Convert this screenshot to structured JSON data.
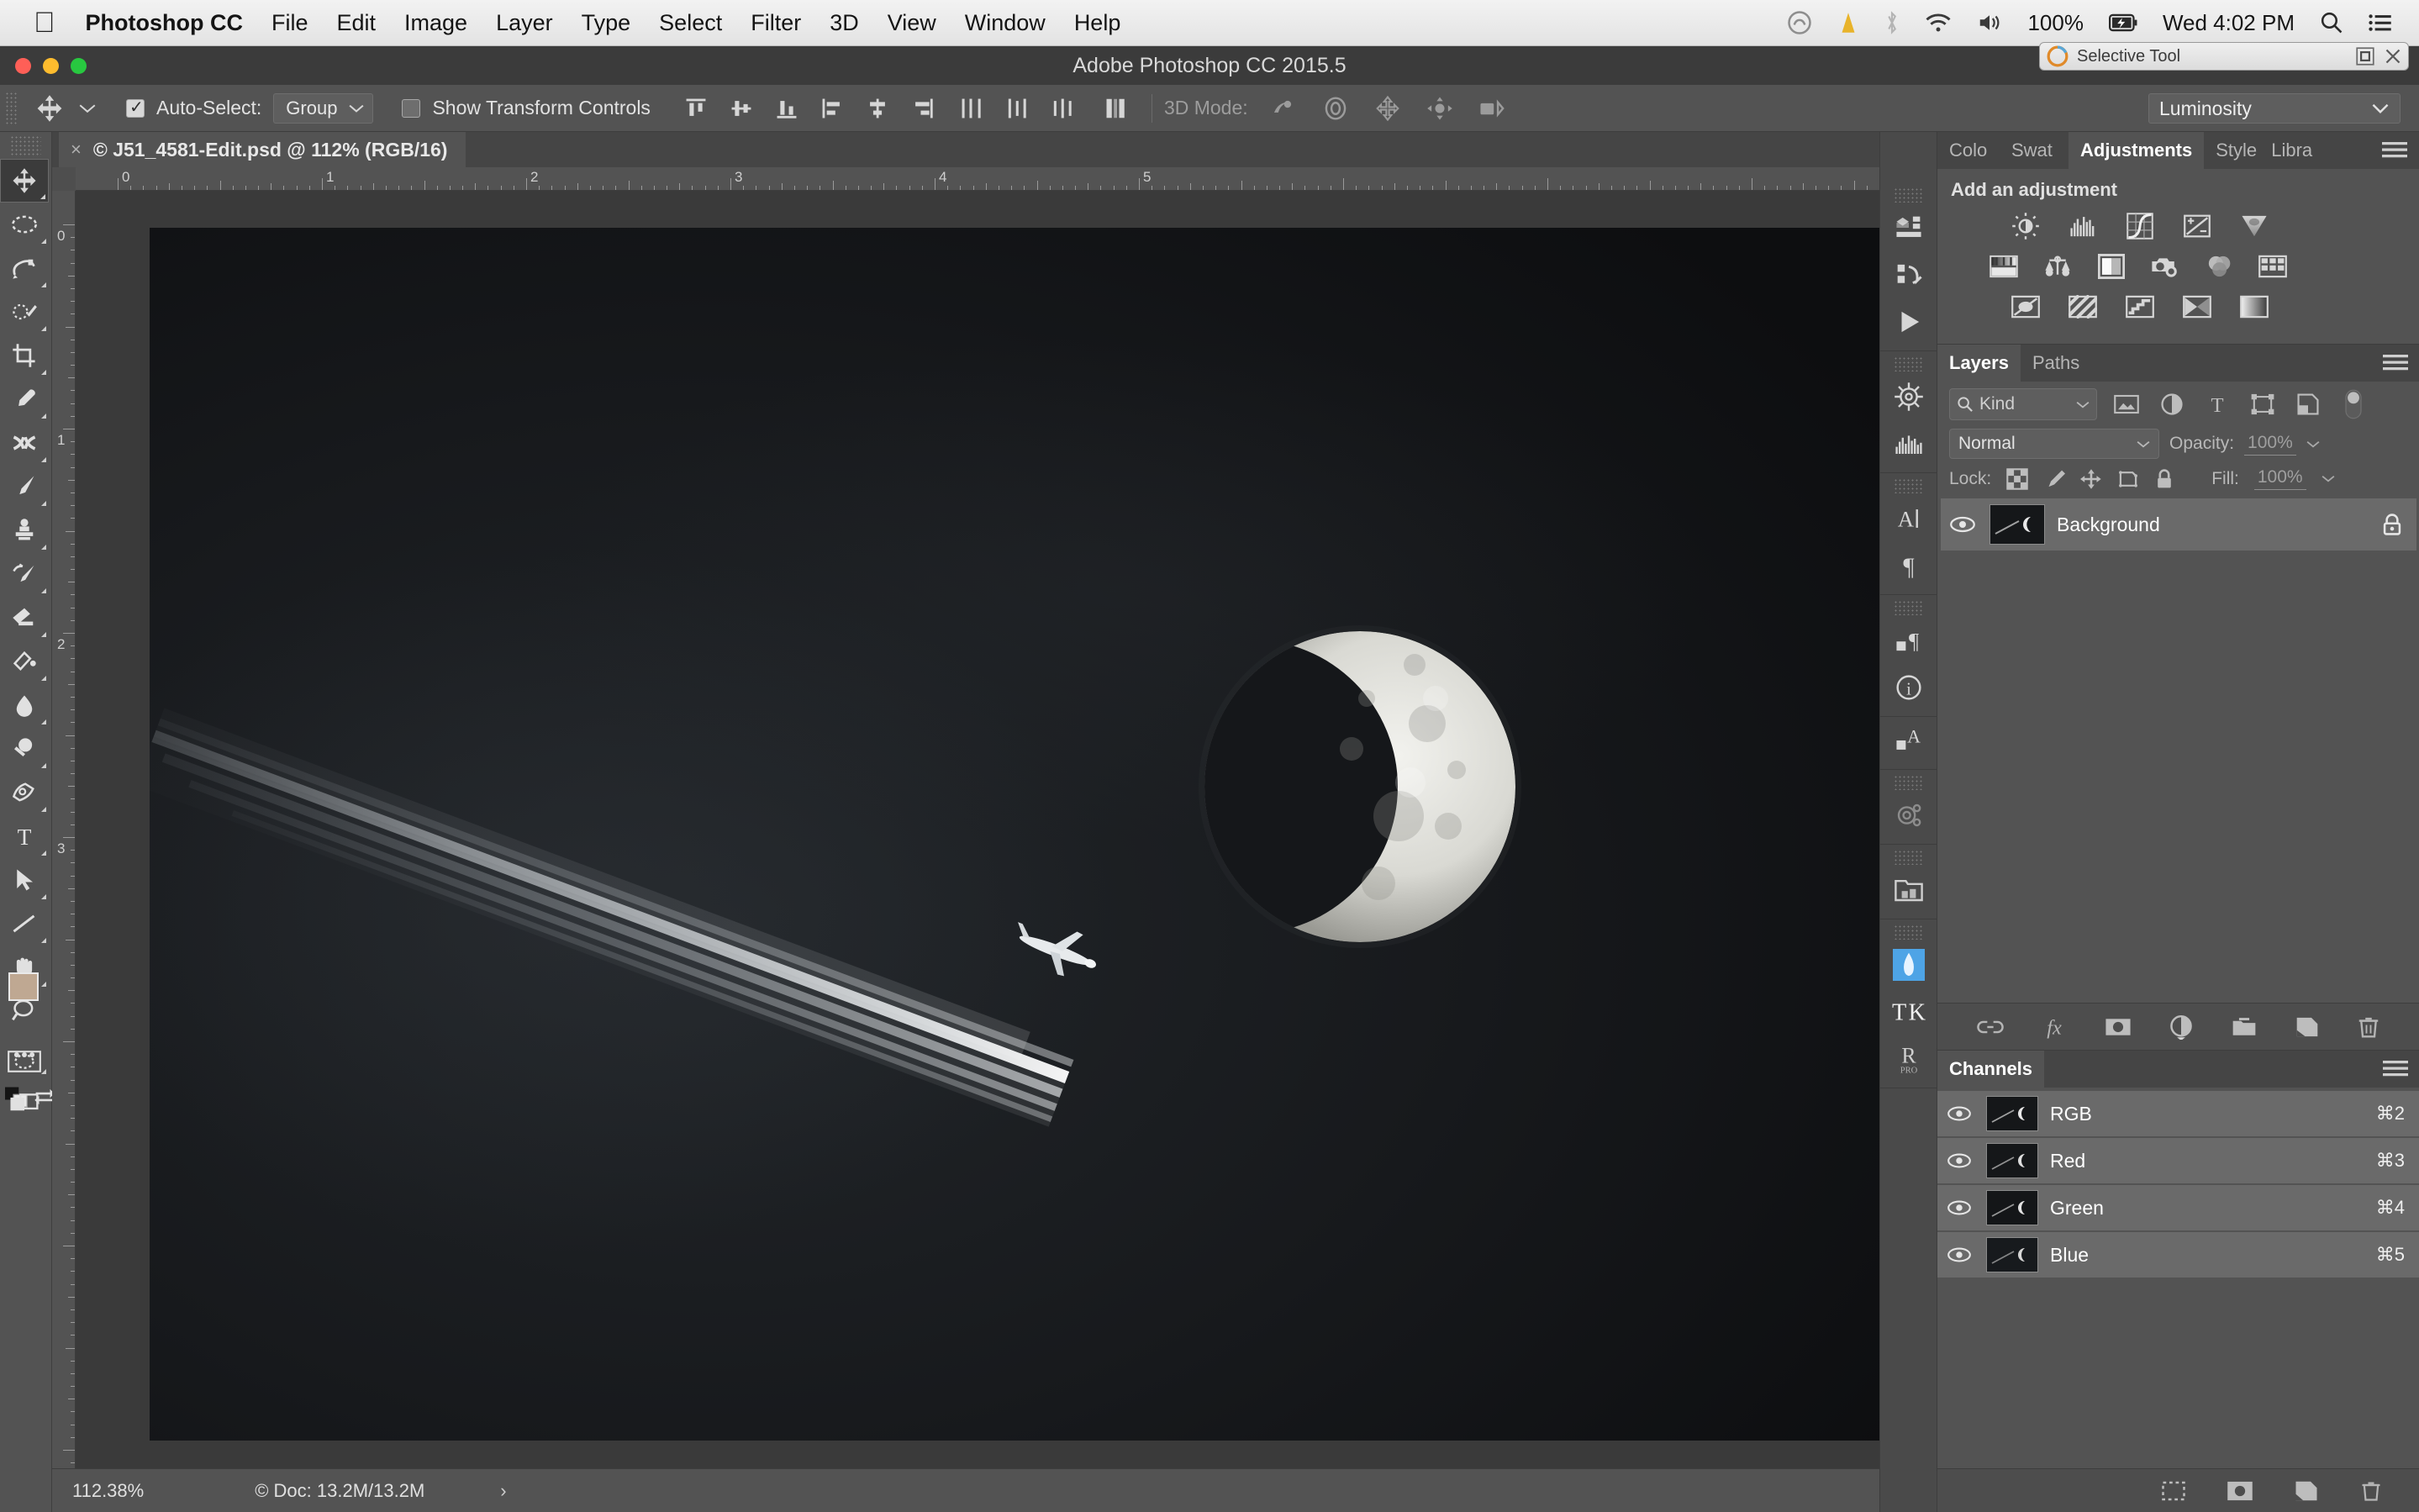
{
  "menubar": {
    "apple_icon": "apple-icon",
    "app_name": "Photoshop CC",
    "items": [
      "File",
      "Edit",
      "Image",
      "Layer",
      "Type",
      "Select",
      "Filter",
      "3D",
      "View",
      "Window",
      "Help"
    ],
    "status": {
      "creative_cloud_icon": "creative-cloud-icon",
      "dropbox_icon": "dropbox-icon",
      "bluetooth_icon": "bluetooth-icon",
      "wifi_icon": "wifi-icon",
      "volume_icon": "volume-icon",
      "battery_percent": "100%",
      "battery_icon": "battery-charging-icon",
      "clock": "Wed 4:02 PM",
      "spotlight_icon": "search-icon",
      "notification_icon": "notification-center-icon"
    }
  },
  "titlebar": {
    "title": "Adobe Photoshop CC 2015.5"
  },
  "selective_tool": {
    "title": "Selective Tool",
    "logo_icon": "selective-tool-logo-icon",
    "maximize_icon": "maximize-icon",
    "close_icon": "close-icon"
  },
  "options_bar": {
    "tool_icon": "move-tool-icon",
    "tool_preset_caret": "chevron-down-icon",
    "auto_select_label": "Auto-Select:",
    "auto_select_checked": true,
    "auto_select_value": "Group",
    "show_transform_label": "Show Transform Controls",
    "show_transform_checked": false,
    "align_icons": [
      "align-top-edges",
      "align-vertical-centers",
      "align-bottom-edges",
      "align-left-edges",
      "align-horizontal-centers",
      "align-right-edges"
    ],
    "distribute_icons": [
      "distribute-top-edges",
      "distribute-vertical-centers",
      "distribute-bottom-edges",
      "distribute-left-edges",
      "distribute-horizontal-centers",
      "distribute-right-edges"
    ],
    "auto_align_icon": "auto-align-layers-icon",
    "mode_3d_label": "3D Mode:",
    "mode_3d_icons": [
      "rotate-3d-object-icon",
      "roll-3d-object-icon",
      "drag-3d-object-icon",
      "slide-3d-object-icon",
      "scale-3d-object-icon"
    ],
    "blend_mode": "Luminosity"
  },
  "document_tab": {
    "close_icon": "close-icon",
    "label": "© J51_4581-Edit.psd @ 112% (RGB/16)"
  },
  "rulers": {
    "horizontal_labels": [
      "0",
      "1",
      "2",
      "3",
      "4",
      "5"
    ],
    "vertical_labels": [
      "0",
      "1",
      "2",
      "3"
    ],
    "unit": "inches"
  },
  "status_bar": {
    "zoom": "112.38%",
    "doc_info": "© Doc: 13.2M/13.2M",
    "expand_icon": "chevron-right-icon"
  },
  "toolbar": {
    "tools": [
      {
        "name": "move-tool",
        "active": true,
        "has_flyout": true
      },
      {
        "name": "elliptical-marquee-tool",
        "active": false,
        "has_flyout": true
      },
      {
        "name": "magnetic-lasso-tool",
        "active": false,
        "has_flyout": true
      },
      {
        "name": "quick-selection-tool",
        "active": false,
        "has_flyout": true
      },
      {
        "name": "crop-tool",
        "active": false,
        "has_flyout": true
      },
      {
        "name": "eyedropper-tool",
        "active": false,
        "has_flyout": true
      },
      {
        "name": "healing-brush-tool",
        "active": false,
        "has_flyout": true
      },
      {
        "name": "brush-tool",
        "active": false,
        "has_flyout": true
      },
      {
        "name": "clone-stamp-tool",
        "active": false,
        "has_flyout": true
      },
      {
        "name": "history-brush-tool",
        "active": false,
        "has_flyout": true
      },
      {
        "name": "eraser-tool",
        "active": false,
        "has_flyout": true
      },
      {
        "name": "gradient-tool",
        "active": false,
        "has_flyout": true
      },
      {
        "name": "blur-tool",
        "active": false,
        "has_flyout": true
      },
      {
        "name": "dodge-tool",
        "active": false,
        "has_flyout": true
      },
      {
        "name": "pen-tool",
        "active": false,
        "has_flyout": true
      },
      {
        "name": "type-tool",
        "active": false,
        "has_flyout": true
      },
      {
        "name": "path-selection-tool",
        "active": false,
        "has_flyout": true
      },
      {
        "name": "line-tool",
        "active": false,
        "has_flyout": true
      },
      {
        "name": "hand-tool",
        "active": false,
        "has_flyout": true
      },
      {
        "name": "zoom-tool",
        "active": false,
        "has_flyout": false
      },
      {
        "name": "edit-toolbar-tool",
        "active": false,
        "has_flyout": true
      }
    ],
    "default_colors_icon": "default-colors-icon",
    "swap_colors_icon": "swap-colors-icon",
    "foreground_color": "#bfa892",
    "background_color": "#ffffff",
    "quick_mask_icon": "quick-mask-mode-icon",
    "screen_mode_icon": "screen-mode-icon"
  },
  "icon_rail": {
    "collapse_icon": "collapse-panels-icon",
    "tk_label": "TK",
    "groups": [
      [
        "3d-panel-icon",
        "3d-actions-icon",
        "play-icon"
      ],
      [
        "navigator-icon",
        "histogram-icon"
      ],
      [
        "character-panel-icon",
        "paragraph-panel-icon"
      ],
      [
        "character-styles-icon",
        "info-panel-icon"
      ],
      [
        "paragraph-styles-icon"
      ],
      [
        "clone-source-icon"
      ],
      [
        "library-folder-icon"
      ],
      [
        "lumenzia-icon",
        "tk-panel-icon",
        "raya-pro-icon"
      ]
    ]
  },
  "adjustments_panel": {
    "tabs": [
      {
        "label": "Colo",
        "active": false
      },
      {
        "label": "Swat",
        "active": false
      },
      {
        "label": "Adjustments",
        "active": true
      },
      {
        "label": "Style",
        "active": false
      },
      {
        "label": "Libra",
        "active": false
      }
    ],
    "menu_icon": "panel-menu-icon",
    "heading": "Add an adjustment",
    "rows": [
      [
        "brightness-contrast-icon",
        "levels-icon",
        "curves-icon",
        "exposure-icon",
        "vibrance-icon"
      ],
      [
        "hue-saturation-icon",
        "color-balance-icon",
        "black-white-icon",
        "photo-filter-icon",
        "channel-mixer-icon",
        "color-lookup-icon"
      ],
      [
        "invert-icon",
        "posterize-icon",
        "threshold-icon",
        "selective-color-icon",
        "gradient-map-icon"
      ]
    ]
  },
  "layers_panel": {
    "tabs": [
      {
        "label": "Layers",
        "active": true
      },
      {
        "label": "Paths",
        "active": false
      }
    ],
    "menu_icon": "panel-menu-icon",
    "filter": {
      "search_icon": "search-icon",
      "kind_label": "Kind",
      "caret_icon": "chevron-down-icon",
      "type_filters": [
        "filter-pixel-icon",
        "filter-adjustment-icon",
        "filter-type-icon",
        "filter-shape-icon",
        "filter-smart-object-icon"
      ],
      "toggle_icon": "filter-toggle-switch"
    },
    "blend_mode": "Normal",
    "blend_caret": "chevron-down-icon",
    "opacity_label": "Opacity:",
    "opacity_value": "100%",
    "lock_label": "Lock:",
    "lock_icons": [
      "lock-transparent-pixels-icon",
      "lock-image-pixels-icon",
      "lock-position-icon",
      "lock-artboard-icon",
      "lock-all-icon"
    ],
    "fill_label": "Fill:",
    "fill_value": "100%",
    "layers": [
      {
        "name": "Background",
        "visible": true,
        "locked": true,
        "selected": true,
        "eye_icon": "eye-icon",
        "lock_icon": "lock-icon"
      }
    ],
    "bottom_icons": [
      "link-layers-icon",
      "layer-style-fx-icon",
      "add-layer-mask-icon",
      "new-adjustment-layer-icon",
      "new-group-icon",
      "new-layer-icon",
      "delete-layer-icon"
    ]
  },
  "channels_panel": {
    "title": "Channels",
    "menu_icon": "panel-menu-icon",
    "channels": [
      {
        "name": "RGB",
        "shortcut": "⌘2",
        "visible": true,
        "eye_icon": "eye-icon",
        "selected": true
      },
      {
        "name": "Red",
        "shortcut": "⌘3",
        "visible": true,
        "eye_icon": "eye-icon",
        "selected": true
      },
      {
        "name": "Green",
        "shortcut": "⌘4",
        "visible": true,
        "eye_icon": "eye-icon",
        "selected": true
      },
      {
        "name": "Blue",
        "shortcut": "⌘5",
        "visible": true,
        "eye_icon": "eye-icon",
        "selected": true
      }
    ],
    "bottom_icons": [
      "load-channel-as-selection-icon",
      "save-selection-as-channel-icon",
      "new-channel-icon",
      "delete-channel-icon"
    ]
  },
  "canvas_image": {
    "description": "Black and white photograph of a crescent moon in a dark night sky with a jet airliner and long contrail streaking diagonally across the frame"
  }
}
